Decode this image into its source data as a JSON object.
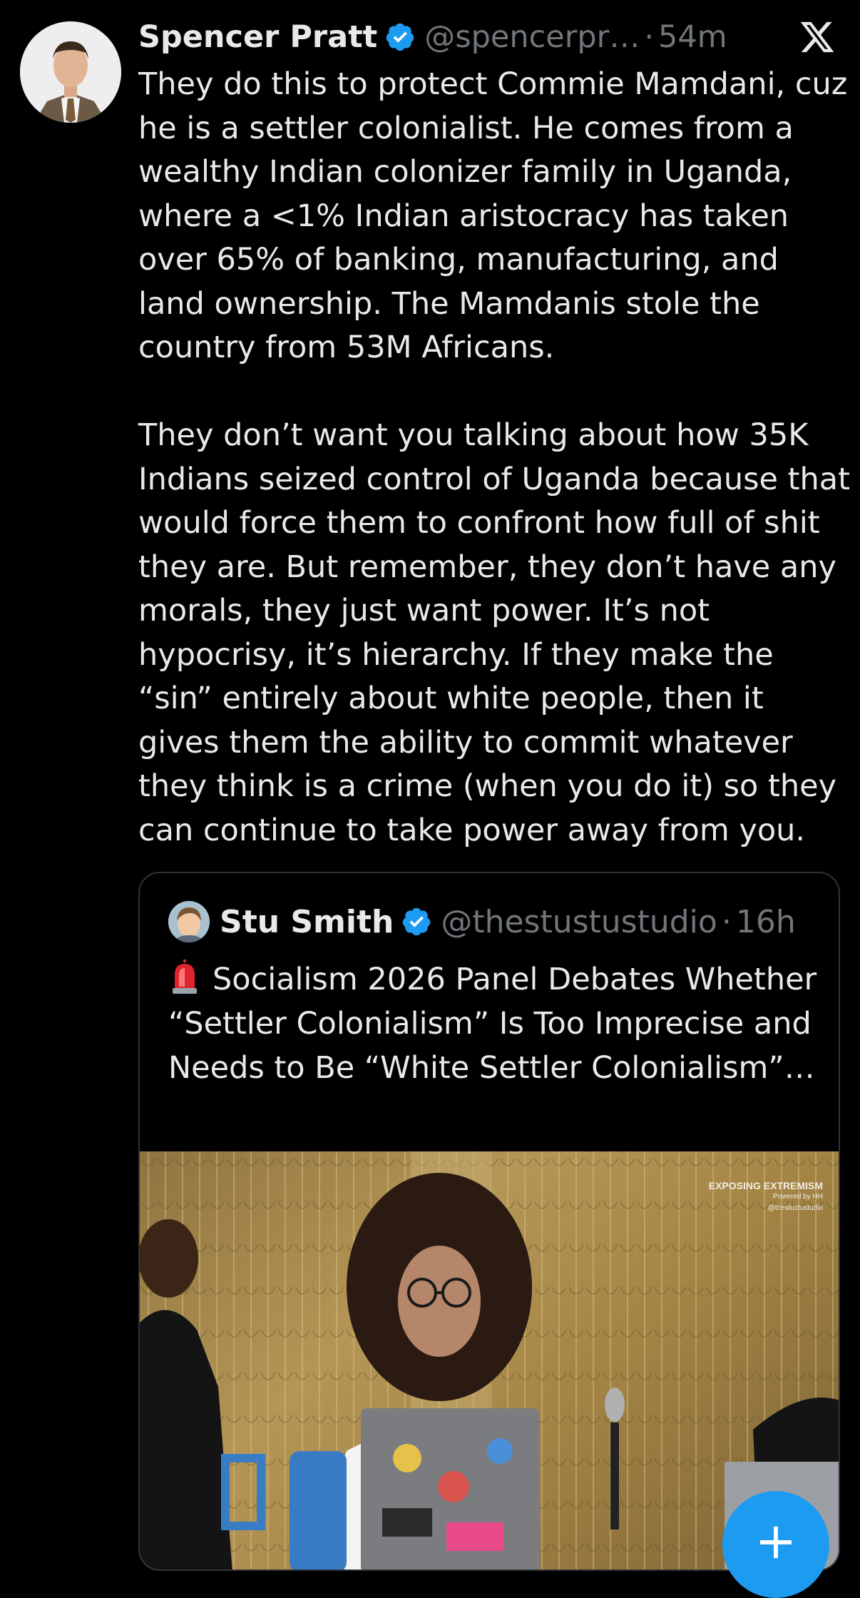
{
  "tweet": {
    "author": {
      "display_name": "Spencer Pratt",
      "handle": "@spencerpr…",
      "verified": true
    },
    "separator": "·",
    "time": "54m",
    "paragraphs": [
      "They do this to protect Commie Mamdani, cuz he is a settler colonialist. He comes from a wealthy Indian colonizer family in Uganda, where a <1% Indian aristocracy has taken over 65% of banking, manufacturing, and land ownership. The Mamdanis stole the country from 53M Africans.",
      "They don’t want you talking about how 35K Indians seized control of Uganda because that would force them to confront how full of shit they are. But remember, they don’t have any morals, they just want power. It’s not hypocrisy, it’s hierarchy. If they make the “sin” entirely about white people, then it gives them the ability to commit whatever they think is a crime (when you do it) so they can continue to take power away from you."
    ]
  },
  "quoted_tweet": {
    "author": {
      "display_name": "Stu Smith",
      "handle": "@thestustustudio",
      "verified": true
    },
    "separator": "·",
    "time": "16h",
    "text": "Socialism 2026 Panel Debates Whether “Settler Colonialism” Is Too Imprecise and Needs to Be “White Settler Colonialism”…",
    "media": {
      "watermark_title": "EXPOSING EXTREMISM",
      "watermark_sub": "Powered by HH",
      "watermark_handle": "@thestustustudio"
    }
  },
  "icons": {
    "verified": "verified-badge-icon",
    "close": "x-logo-icon",
    "siren": "rotating-light-icon",
    "compose": "plus-icon"
  },
  "colors": {
    "background": "#000000",
    "text": "#e7e9ea",
    "muted": "#71767b",
    "accent": "#1d9bf0",
    "border": "#2f3336"
  },
  "fab": {
    "label": "+"
  }
}
